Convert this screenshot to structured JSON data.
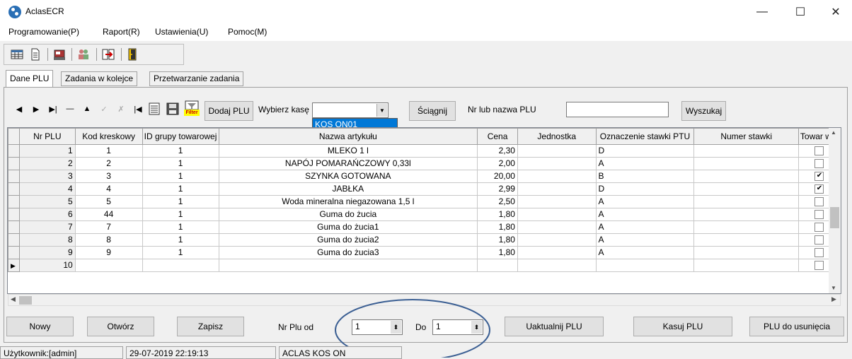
{
  "window": {
    "title": "AclasECR",
    "minimize": "—",
    "maximize": "☐",
    "close": "✕"
  },
  "menu": [
    "Programowanie(P)",
    "Raport(R)",
    "Ustawienia(U)",
    "Pomoc(M)"
  ],
  "tabs": [
    "Dane PLU",
    "Zadania w kolejce",
    "Przetwarzanie zadania"
  ],
  "nav": {
    "first": "◀",
    "next": "▶",
    "last": "▶|",
    "delete": "—",
    "up": "▲",
    "post": "✓",
    "cancel": "✗",
    "refresh": "|◀"
  },
  "toolbar2": {
    "filter_label": "Filter",
    "add_plu": "Dodaj PLU",
    "choose_register_label": "Wybierz kasę",
    "choose_register_value": "",
    "register_option": "KOS ON01",
    "download": "Ściągnij",
    "plu_search_label": "Nr lub nazwa PLU",
    "plu_search_value": "",
    "search": "Wyszukaj"
  },
  "grid": {
    "columns": [
      "Nr PLU",
      "Kod kreskowy",
      "ID grupy towarowej",
      "Nazwa artykułu",
      "Cena",
      "Jednostka",
      "Oznaczenie stawki PTU",
      "Numer stawki",
      "Towar wa:"
    ],
    "rows": [
      {
        "nr": "1",
        "kod": "1",
        "grupa": "1",
        "nazwa": "MLEKO 1 l",
        "cena": "2,30",
        "jednostka": "",
        "ptu": "D",
        "numer": "",
        "checked": false
      },
      {
        "nr": "2",
        "kod": "2",
        "grupa": "1",
        "nazwa": "NAPÓJ POMARAŃCZOWY 0,33l",
        "cena": "2,00",
        "jednostka": "",
        "ptu": "A",
        "numer": "",
        "checked": false
      },
      {
        "nr": "3",
        "kod": "3",
        "grupa": "1",
        "nazwa": "SZYNKA GOTOWANA",
        "cena": "20,00",
        "jednostka": "",
        "ptu": "B",
        "numer": "",
        "checked": true
      },
      {
        "nr": "4",
        "kod": "4",
        "grupa": "1",
        "nazwa": "JABŁKA",
        "cena": "2,99",
        "jednostka": "",
        "ptu": "D",
        "numer": "",
        "checked": true
      },
      {
        "nr": "5",
        "kod": "5",
        "grupa": "1",
        "nazwa": "Woda mineralna niegazowana 1,5 l",
        "cena": "2,50",
        "jednostka": "",
        "ptu": "A",
        "numer": "",
        "checked": false
      },
      {
        "nr": "6",
        "kod": "44",
        "grupa": "1",
        "nazwa": "Guma do żucia",
        "cena": "1,80",
        "jednostka": "",
        "ptu": "A",
        "numer": "",
        "checked": false
      },
      {
        "nr": "7",
        "kod": "7",
        "grupa": "1",
        "nazwa": "Guma do żucia1",
        "cena": "1,80",
        "jednostka": "",
        "ptu": "A",
        "numer": "",
        "checked": false
      },
      {
        "nr": "8",
        "kod": "8",
        "grupa": "1",
        "nazwa": "Guma do żucia2",
        "cena": "1,80",
        "jednostka": "",
        "ptu": "A",
        "numer": "",
        "checked": false
      },
      {
        "nr": "9",
        "kod": "9",
        "grupa": "1",
        "nazwa": "Guma do żucia3",
        "cena": "1,80",
        "jednostka": "",
        "ptu": "A",
        "numer": "",
        "checked": false
      },
      {
        "nr": "10",
        "kod": "",
        "grupa": "",
        "nazwa": "",
        "cena": "",
        "jednostka": "",
        "ptu": "",
        "numer": "",
        "checked": false
      }
    ]
  },
  "bottom": {
    "new": "Nowy",
    "open": "Otwórz",
    "save": "Zapisz",
    "plu_from_label": "Nr Plu od",
    "plu_from_value": "1",
    "plu_to_label": "Do",
    "plu_to_value": "1",
    "update": "Uaktualnij PLU",
    "delete": "Kasuj PLU",
    "to_remove": "PLU do usunięcia"
  },
  "status": {
    "user": "Użytkownik:[admin]",
    "datetime": "29-07-2019 22:19:13",
    "device": "ACLAS KOS ON"
  },
  "colors": {
    "highlight": "#0078d7",
    "annotation": "#3b5f93",
    "accent": "#2a6fb5"
  }
}
